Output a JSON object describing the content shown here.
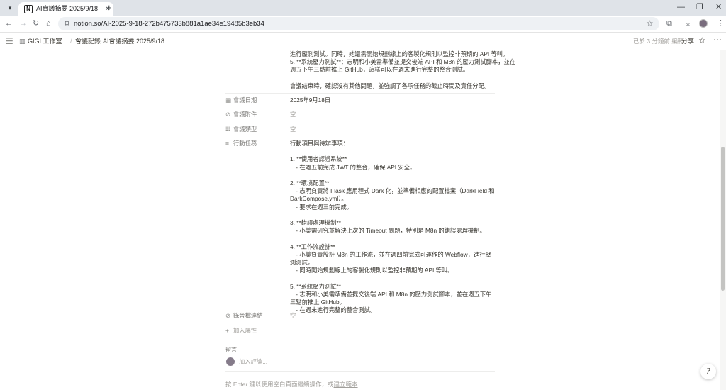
{
  "browser": {
    "tab_title": "AI會議摘要 2025/9/18",
    "tab_favicon": "N",
    "url": "notion.so/AI-2025-9-18-272b475733b881a1ae34e19485b3eb34"
  },
  "topbar": {
    "workspace": "GIGI 工作室",
    "ellipsis": "...",
    "crumb_parent": "會議記錄",
    "crumb_current": "AI會議摘要 2025/9/18",
    "edited": "已於 3 分鐘前 編輯",
    "share": "分享"
  },
  "body": {
    "top_lines": [
      "進行壓測測試。同時，她還需開始規劃線上的客製化規則以監控非預期的 API 等叫。",
      "5. **系統壓力測試**：志明和小美需準備並提交後端 API 和 M8n 的壓力測試腳本，並在",
      "週五下午三點前推上 GitHub，這樣可以在週末進行完整的整合測試。",
      "",
      "會議結束時，確認沒有其他問題，並強調了各項任務的截止時間及責任分配。"
    ]
  },
  "properties": {
    "date_label": "會議日期",
    "date_value": "2025年9月18日",
    "attach_label": "會議附件",
    "attach_value": "空",
    "type_label": "會議類型",
    "type_value": "空",
    "action_label": "行動任務",
    "action_lines": [
      "行動項目與待辦事項：",
      "",
      "1. **使用者認證系統**",
      "　- 在週五前完成 JWT 的整合，確保 API 安全。",
      "",
      "2. **環境配置**",
      "　- 志明負責將 Flask 應用程式 Dark 化，並準備相應的配置檔案（DarkField 和 DarkCompose.yml）。",
      "　- 要求在週三前完成。",
      "",
      "3. **錯誤處理機制**",
      "　- 小美需研究並解決上次的 Timeout 問題，特別是 M8n 的錯誤處理機制。",
      "",
      "4. **工作流設計**",
      "　- 小美負責設計 M8n 的工作流，並在週四前完成可運作的 Webflow，進行壓測測試。",
      "　- 同時開始規劃線上的客製化規則以監控非預期的 API 等叫。",
      "",
      "5. **系統壓力測試**",
      "　- 志明和小美需準備並提交後端 API 和 M8n 的壓力測試腳本，並在週五下午三點前推上 GitHub。",
      "　- 在週末進行完整的整合測試。"
    ],
    "recording_label": "錄音檔連結",
    "recording_value": "空",
    "add_property": "加入屬性"
  },
  "comments": {
    "title": "留言",
    "placeholder": "加入評論..."
  },
  "empty_hint": {
    "prefix": "按 Enter 鍵以使用空白頁面繼續操作，或",
    "link": "建立範本"
  },
  "help": "?"
}
